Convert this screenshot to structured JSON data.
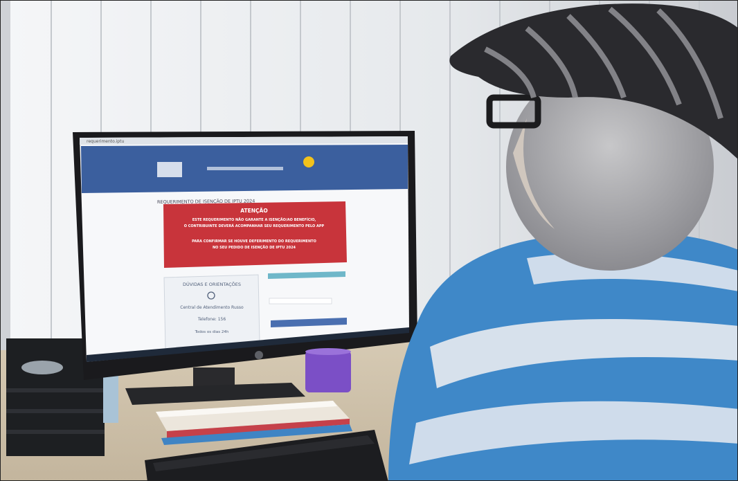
{
  "photo": {
    "colors": {
      "blind": "#eef0f2",
      "blind_shadow": "#d3d6da",
      "desk": "#d9cdb8",
      "monitor_bezel": "#1a1a1d",
      "site_header": "#3b5f9e",
      "alert_red": "#c8343b",
      "shirt_blue": "#3f88c8",
      "shirt_white": "#dfe6ee",
      "cap": "#2a2a2e",
      "mug": "#7b4fc6"
    }
  },
  "screen": {
    "browser_url": "requerimento.iptu",
    "page_heading": "REQUERIMENTO DE ISENÇÃO DE IPTU 2024",
    "alert": {
      "title": "ATENÇÃO",
      "line1": "ESTE REQUERIMENTO NÃO GARANTE A ISENÇÃO/AO BENEFÍCIO,",
      "line2": "O CONTRIBUINTE DEVERÁ ACOMPANHAR SEU REQUERIMENTO PELO APP",
      "line3": "PARA CONFIRMAR SE HOUVE DEFERIMENTO DO REQUERIMENTO",
      "line4": "NO SEU PEDIDO DE ISENÇÃO DE IPTU 2024"
    },
    "info_box": {
      "title": "DÚVIDAS E ORIENTAÇÕES",
      "line1": "Central de Atendimento Russo",
      "line2": "Telefone: 156",
      "line3": "Todos os dias 24h"
    }
  }
}
